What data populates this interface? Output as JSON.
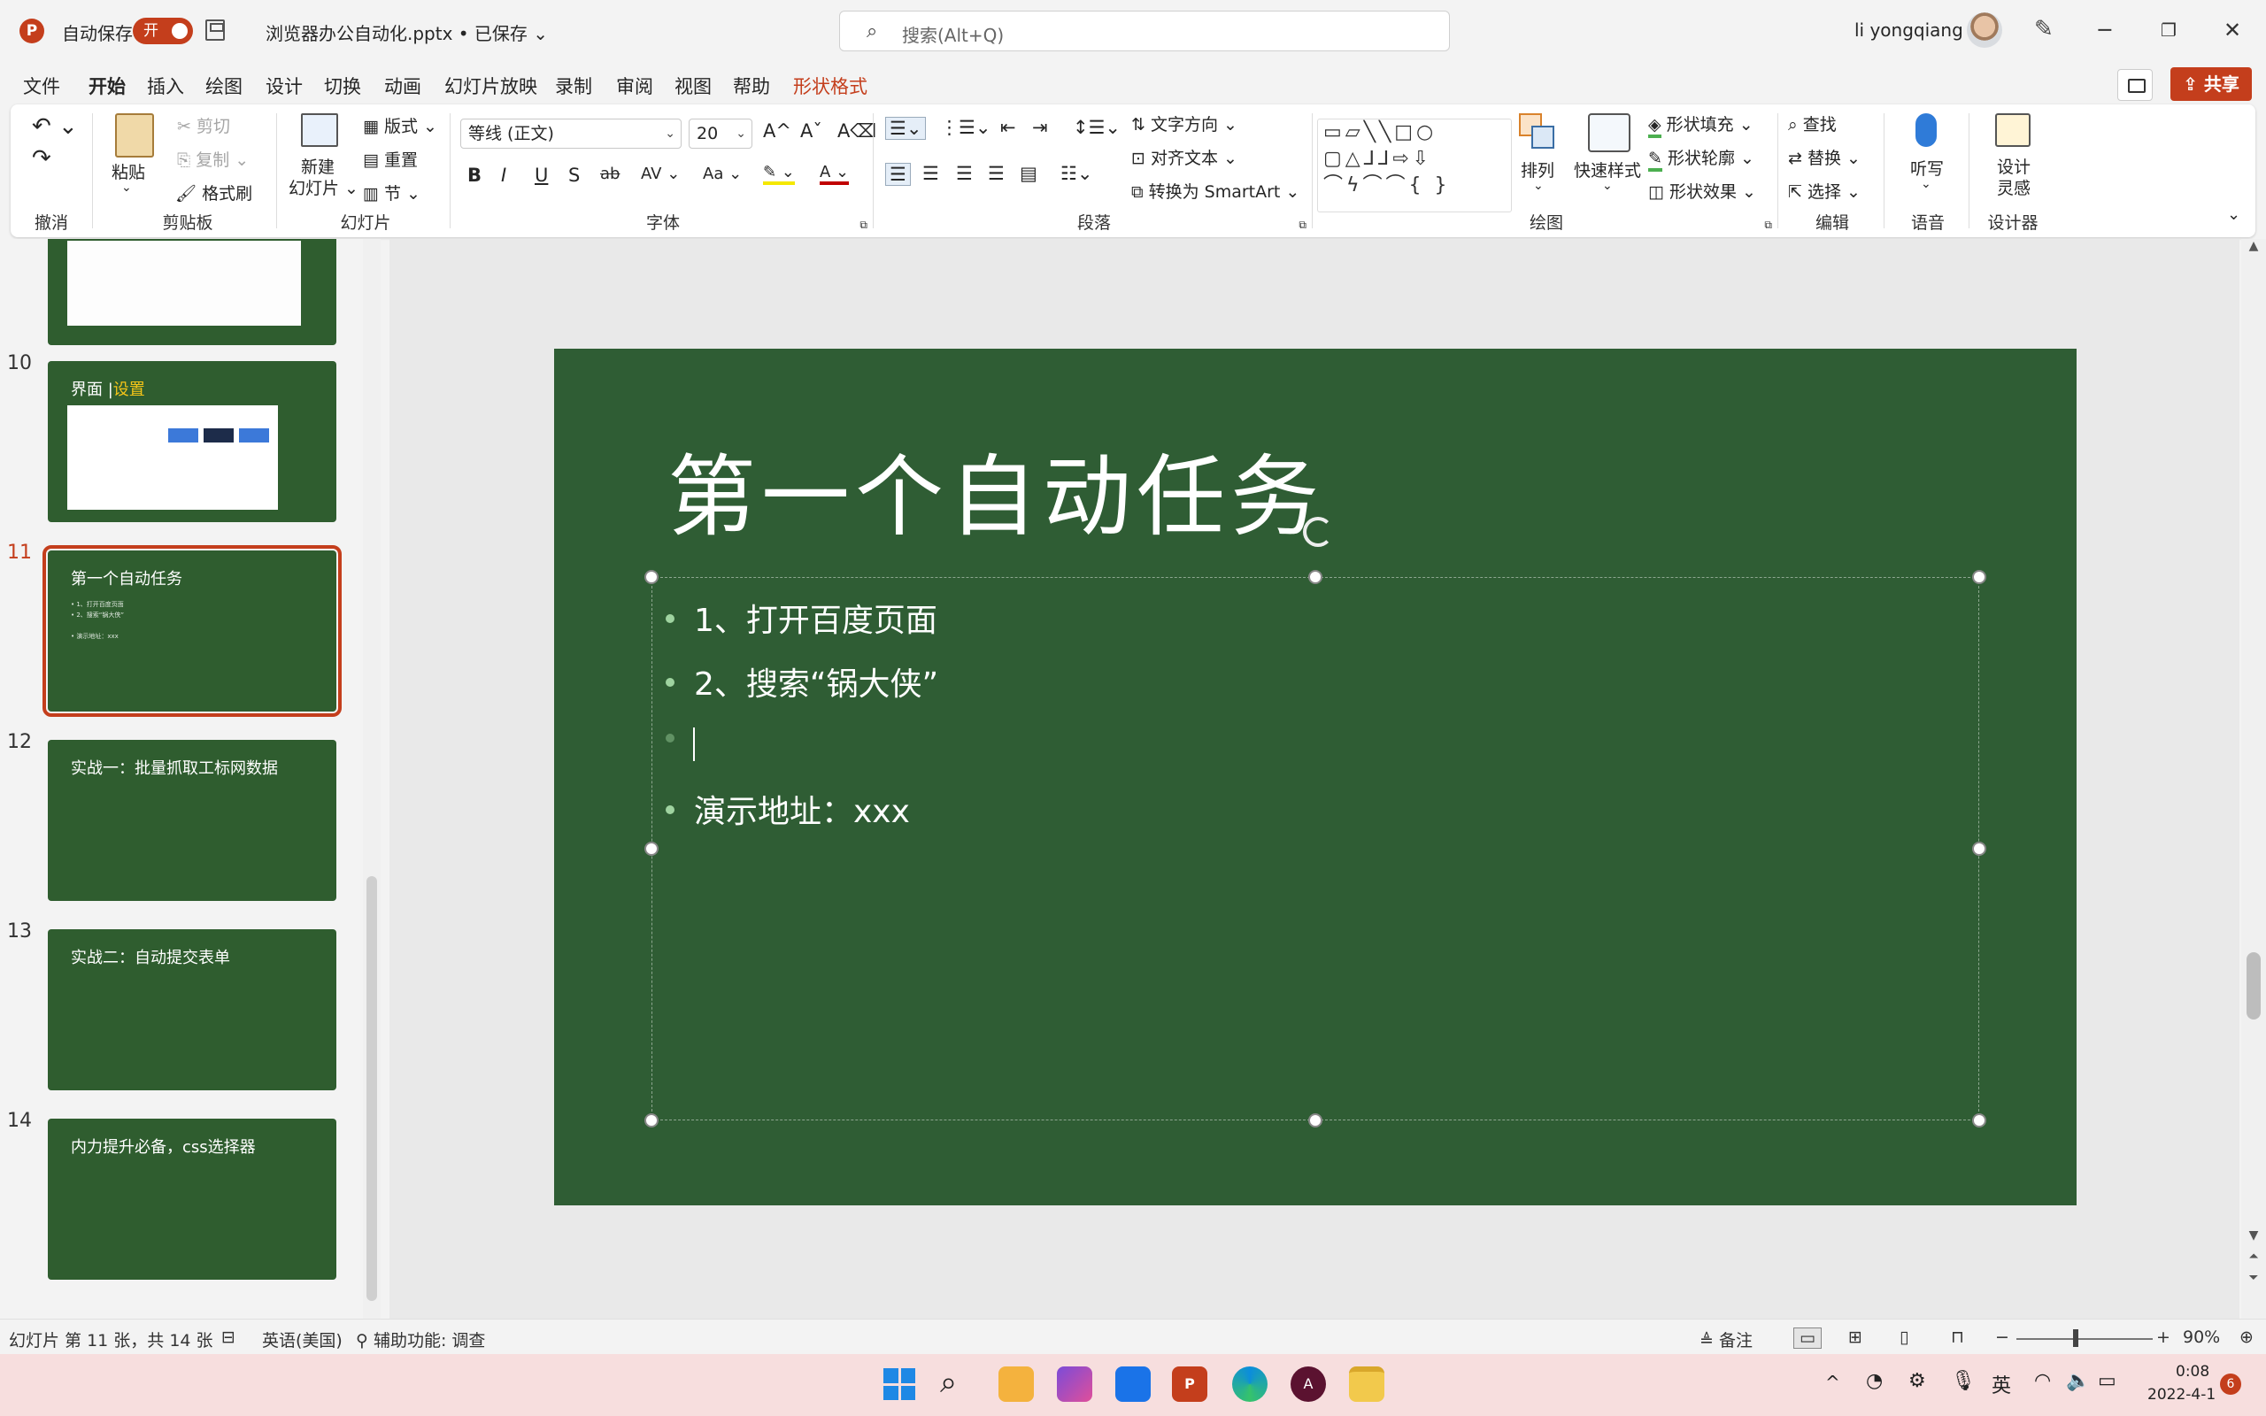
{
  "titlebar": {
    "app_logo": "P",
    "autosave_label": "自动保存",
    "autosave_state": "开",
    "doc_title": "浏览器办公自动化.pptx • 已保存 ⌄",
    "search_placeholder": "搜索(Alt+Q)",
    "user_name": "li yongqiang",
    "minimize": "─",
    "restore": "❐",
    "close": "✕"
  },
  "menu": {
    "tabs": [
      "文件",
      "开始",
      "插入",
      "绘图",
      "设计",
      "切换",
      "动画",
      "幻灯片放映",
      "录制",
      "审阅",
      "视图",
      "帮助",
      "形状格式"
    ],
    "active_tab": "开始",
    "share_label": "共享"
  },
  "ribbon": {
    "undo": {
      "undo_icon": "↶ ⌄",
      "redo_icon": "↷",
      "label": "撤消"
    },
    "clipboard": {
      "paste": "粘贴",
      "cut": "剪切",
      "copy": "复制",
      "format_painter": "格式刷",
      "label": "剪贴板"
    },
    "slides": {
      "new_slide": "新建",
      "new_slide_2": "幻灯片 ⌄",
      "layout": "版式 ⌄",
      "reset": "重置",
      "section": "节 ⌄",
      "label": "幻灯片"
    },
    "font": {
      "font_name": "等线 (正文)",
      "font_size": "20",
      "grow": "A^",
      "shrink": "Aˇ",
      "clear": "A⌫",
      "bold": "B",
      "italic": "I",
      "underline": "U",
      "shadow": "S",
      "strike": "ab",
      "spacing": "AV ⌄",
      "case": "Aa ⌄",
      "highlight": "✎ ⌄",
      "color": "A ⌄",
      "label": "字体"
    },
    "paragraph": {
      "text_direction": "文字方向 ⌄",
      "align_text": "对齐文本 ⌄",
      "smartart": "转换为 SmartArt ⌄",
      "label": "段落"
    },
    "drawing": {
      "shapes": "▭▱╲╲□○ ▢△⅃⅃⇨⇩ ⌒ϟ⌒⌒{ }",
      "arrange": "排列",
      "quick_styles": "快速样式",
      "fill": "形状填充 ⌄",
      "outline": "形状轮廓 ⌄",
      "effects": "形状效果 ⌄",
      "label": "绘图"
    },
    "editing": {
      "find": "查找",
      "replace": "替换 ⌄",
      "select": "选择 ⌄",
      "label": "编辑"
    },
    "voice": {
      "dictate": "听写",
      "label": "语音"
    },
    "designer": {
      "design_ideas": "设计",
      "design_ideas_2": "灵感",
      "label": "设计器"
    }
  },
  "slides": [
    {
      "number": "10",
      "title": "界面 |",
      "title_accent": "设置"
    },
    {
      "number": "11",
      "title": "第一个自动任务",
      "mini_lines": [
        "• 1、打开百度页面",
        "• 2、搜索“锅大侠”",
        "• 演示地址：xxx"
      ]
    },
    {
      "number": "12",
      "title": "实战一：批量抓取工标网数据"
    },
    {
      "number": "13",
      "title": "实战二：自动提交表单"
    },
    {
      "number": "14",
      "title": "内力提升必备，css选择器"
    }
  ],
  "current_slide": {
    "title": "第一个自动任务",
    "bullets": [
      "1、打开百度页面",
      "2、搜索“锅大侠”",
      "",
      "演示地址：xxx"
    ]
  },
  "statusbar": {
    "slide_info": "幻灯片 第 11 张，共 14 张",
    "language": "英语(美国)",
    "accessibility": "辅助功能: 调查",
    "notes": "备注",
    "zoom_level": "90%"
  },
  "taskbar": {
    "tray_lang": "英",
    "time": "0:08",
    "date": "2022-4-1",
    "notification_count": "6"
  },
  "colors": {
    "accent": "#c43e1c",
    "slide_bg": "#2f5d34",
    "title_accent": "#f5c518"
  }
}
